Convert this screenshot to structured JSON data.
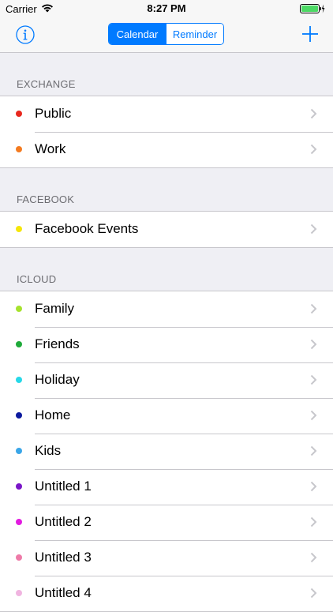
{
  "status_bar": {
    "carrier": "Carrier",
    "time": "8:27 PM"
  },
  "nav": {
    "segments": [
      {
        "label": "Calendar",
        "selected": true
      },
      {
        "label": "Reminder",
        "selected": false
      }
    ],
    "icons": {
      "left": "info-icon",
      "right": "plus-icon"
    },
    "accent_color": "#007aff"
  },
  "sections": [
    {
      "title": "EXCHANGE",
      "items": [
        {
          "label": "Public",
          "color": "#e8281e"
        },
        {
          "label": "Work",
          "color": "#f47b20"
        }
      ]
    },
    {
      "title": "FACEBOOK",
      "items": [
        {
          "label": "Facebook Events",
          "color": "#f5e60a"
        }
      ]
    },
    {
      "title": "ICLOUD",
      "items": [
        {
          "label": "Family",
          "color": "#a6e22e"
        },
        {
          "label": "Friends",
          "color": "#1faa3a"
        },
        {
          "label": "Holiday",
          "color": "#27d8e8"
        },
        {
          "label": "Home",
          "color": "#0c1a9e"
        },
        {
          "label": "Kids",
          "color": "#3aa6e8"
        },
        {
          "label": "Untitled 1",
          "color": "#7a16c8"
        },
        {
          "label": "Untitled 2",
          "color": "#e21be0"
        },
        {
          "label": "Untitled 3",
          "color": "#ee7aa8"
        },
        {
          "label": "Untitled 4",
          "color": "#f0b4e0"
        }
      ]
    }
  ]
}
